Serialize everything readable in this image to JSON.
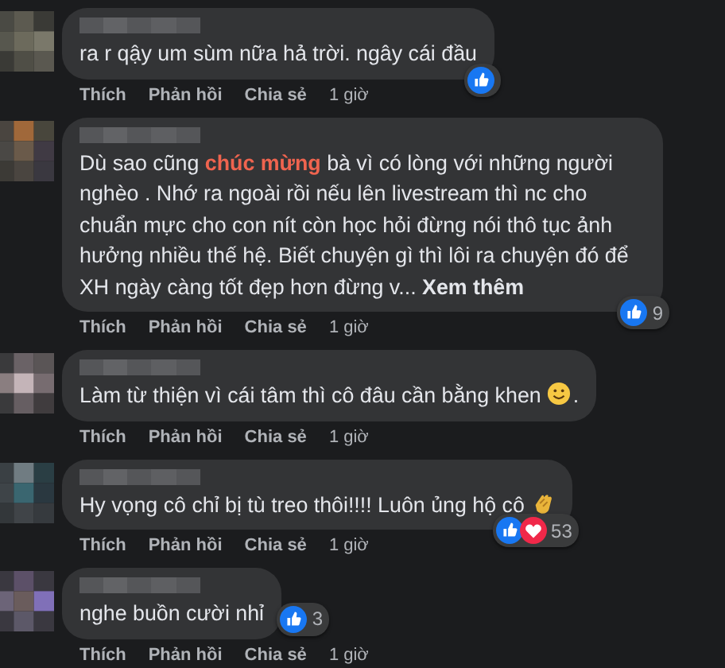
{
  "comments": [
    {
      "text": "ra r qậy um sùm nữa hả trời. ngây cái đầu",
      "reactions": [
        {
          "kind": "like"
        }
      ],
      "actions": [
        "Thích",
        "Phản hồi",
        "Chia sẻ"
      ],
      "time": "1 giờ"
    },
    {
      "text": "Dù sao cũng **chúc mừng** bà vì có lòng với những người nghèo . Nhớ ra ngoài rồi nếu lên livestream thì nc cho chuẩn mực cho con nít còn học hỏi đừng nói thô tục ảnh hưởng nhiều thế hệ. Biết chuyện gì thì lôi ra chuyện đó để XH ngày càng tốt đẹp hơn đừng v...",
      "see_more": "Xem thêm",
      "reactions": [
        {
          "kind": "like"
        }
      ],
      "count": "9",
      "actions": [
        "Thích",
        "Phản hồi",
        "Chia sẻ"
      ],
      "time": "1 giờ"
    },
    {
      "text": "Làm từ thiện vì cái tâm thì cô đâu cần bằng khen",
      "emoji": {
        "kind": "smile"
      },
      "after_emoji": ".",
      "actions": [
        "Thích",
        "Phản hồi",
        "Chia sẻ"
      ],
      "time": "1 giờ"
    },
    {
      "text": "Hy vọng cô chỉ bị tù treo thôi!!!! Luôn ủng hộ cô",
      "emoji": {
        "kind": "clap"
      },
      "reactions": [
        {
          "kind": "like"
        },
        {
          "kind": "love"
        }
      ],
      "count": "53",
      "actions": [
        "Thích",
        "Phản hồi",
        "Chia sẻ"
      ],
      "time": "1 giờ"
    },
    {
      "text": "nghe buồn cười nhỉ",
      "reactions": [
        {
          "kind": "like"
        }
      ],
      "count": "3",
      "actions": [
        "Thích",
        "Phản hồi",
        "Chia sẻ"
      ],
      "time": "1 giờ"
    }
  ]
}
